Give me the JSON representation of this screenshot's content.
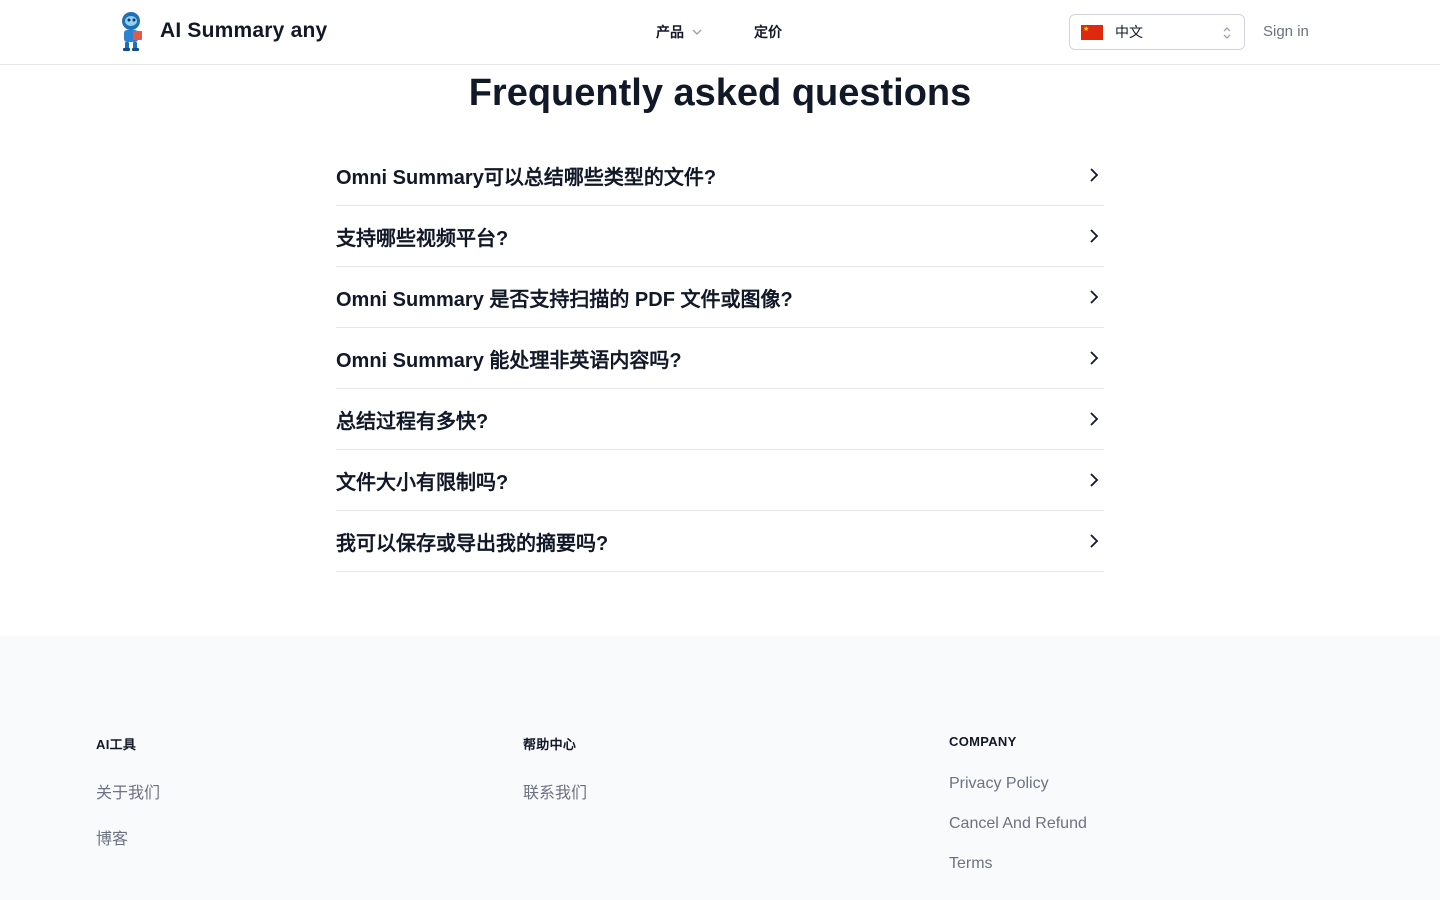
{
  "header": {
    "logo_text": "AI Summary any",
    "nav": {
      "products_label": "产品",
      "pricing_label": "定价"
    },
    "language": {
      "selected": "中文"
    },
    "sign_in_label": "Sign in"
  },
  "faq": {
    "title": "Frequently asked questions",
    "questions": [
      "Omni Summary可以总结哪些类型的文件?",
      "支持哪些视频平台?",
      "Omni Summary 是否支持扫描的 PDF 文件或图像?",
      "Omni Summary 能处理非英语内容吗?",
      "总结过程有多快?",
      "文件大小有限制吗?",
      "我可以保存或导出我的摘要吗?"
    ]
  },
  "footer": {
    "columns": [
      {
        "heading": "AI工具",
        "links": [
          "关于我们",
          "博客"
        ]
      },
      {
        "heading": "帮助中心",
        "links": [
          "联系我们"
        ]
      },
      {
        "heading": "COMPANY",
        "links": [
          "Privacy Policy",
          "Cancel And Refund",
          "Terms"
        ]
      }
    ]
  },
  "colors": {
    "text_primary": "#111827",
    "text_muted": "#6b7280",
    "border": "#e5e7eb",
    "footer_bg": "#f9fafb"
  }
}
